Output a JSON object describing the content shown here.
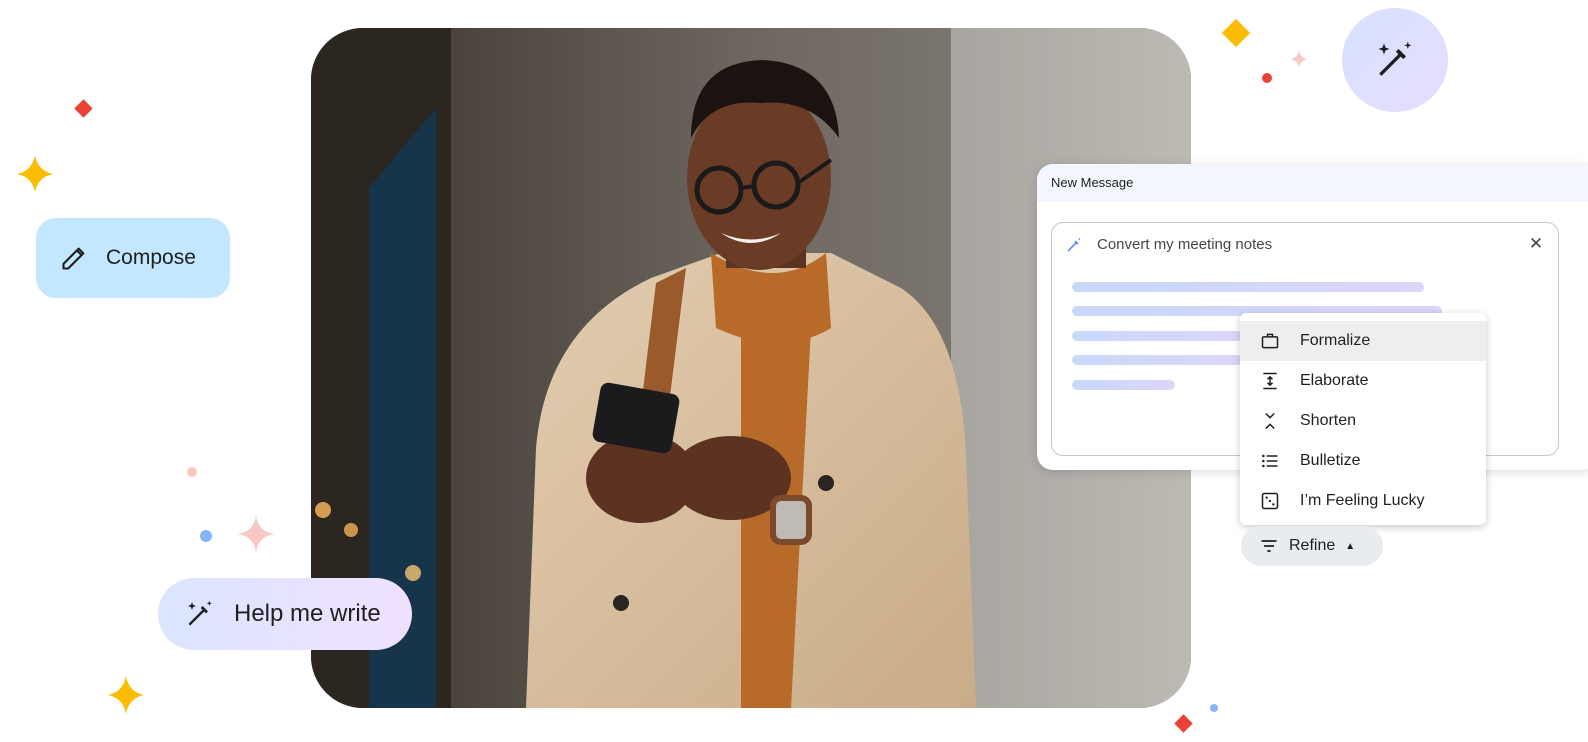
{
  "compose": {
    "label": "Compose",
    "icon": "pencil-icon"
  },
  "help_me_write": {
    "label": "Help me write",
    "icon": "magic-wand-icon"
  },
  "wand_badge": {
    "icon": "magic-wand-icon"
  },
  "new_message": {
    "title": "New Message",
    "prompt": "Convert my meeting notes",
    "prompt_icon": "magic-wand-icon",
    "close_label": "✕"
  },
  "refine_menu": {
    "items": [
      {
        "label": "Formalize",
        "icon": "briefcase-icon",
        "highlighted": true
      },
      {
        "label": "Elaborate",
        "icon": "expand-vertical-icon",
        "highlighted": false
      },
      {
        "label": "Shorten",
        "icon": "collapse-vertical-icon",
        "highlighted": false
      },
      {
        "label": "Bulletize",
        "icon": "bulleted-list-icon",
        "highlighted": false
      },
      {
        "label": "I’m Feeling Lucky",
        "icon": "dice-icon",
        "highlighted": false
      }
    ]
  },
  "refine_button": {
    "label": "Refine",
    "icon": "filter-lines-icon",
    "caret": "▲"
  },
  "colors": {
    "compose_bg": "#c2e7ff",
    "accent_blue": "#4285f4",
    "accent_yellow": "#fbbc04",
    "accent_red": "#ea4335"
  }
}
